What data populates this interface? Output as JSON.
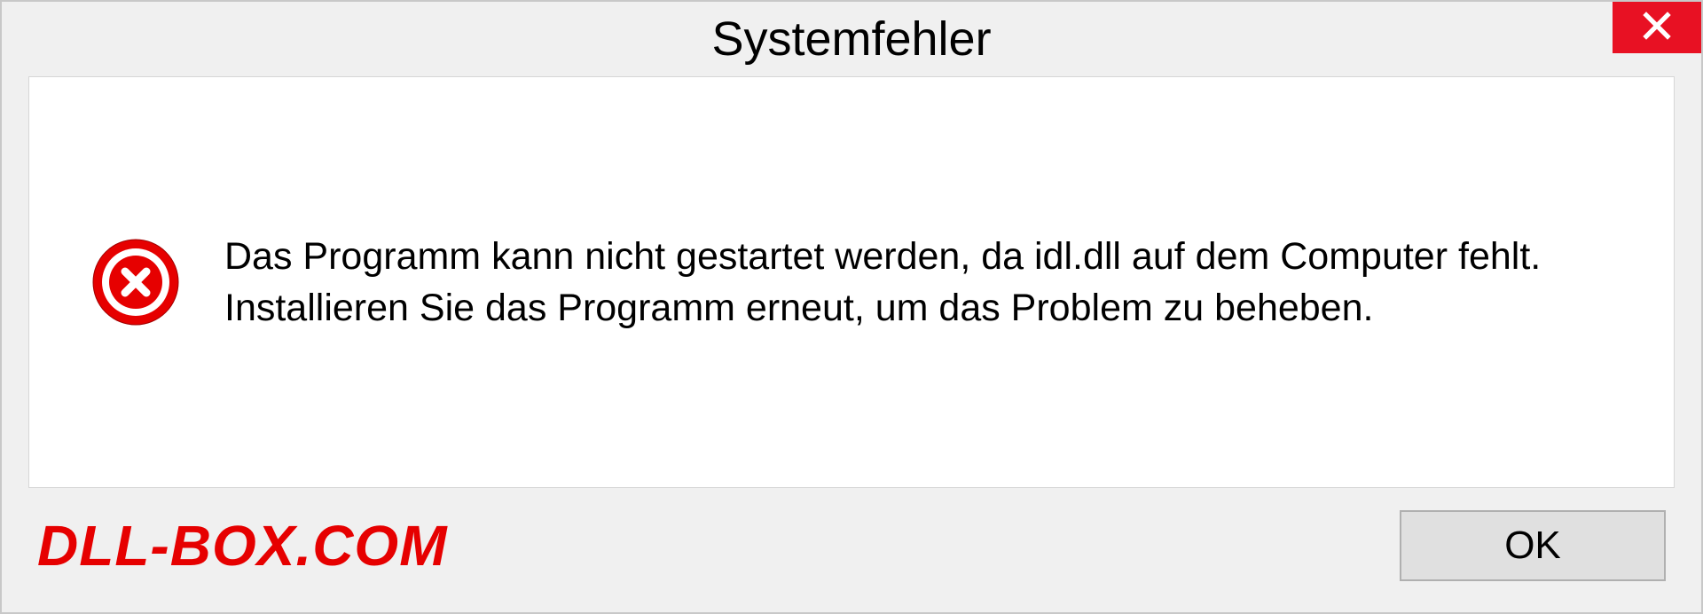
{
  "dialog": {
    "title": "Systemfehler",
    "message": "Das Programm kann nicht gestartet werden, da idl.dll auf dem Computer fehlt. Installieren Sie das Programm erneut, um das Problem zu beheben.",
    "ok_label": "OK"
  },
  "watermark": "DLL-BOX.COM"
}
